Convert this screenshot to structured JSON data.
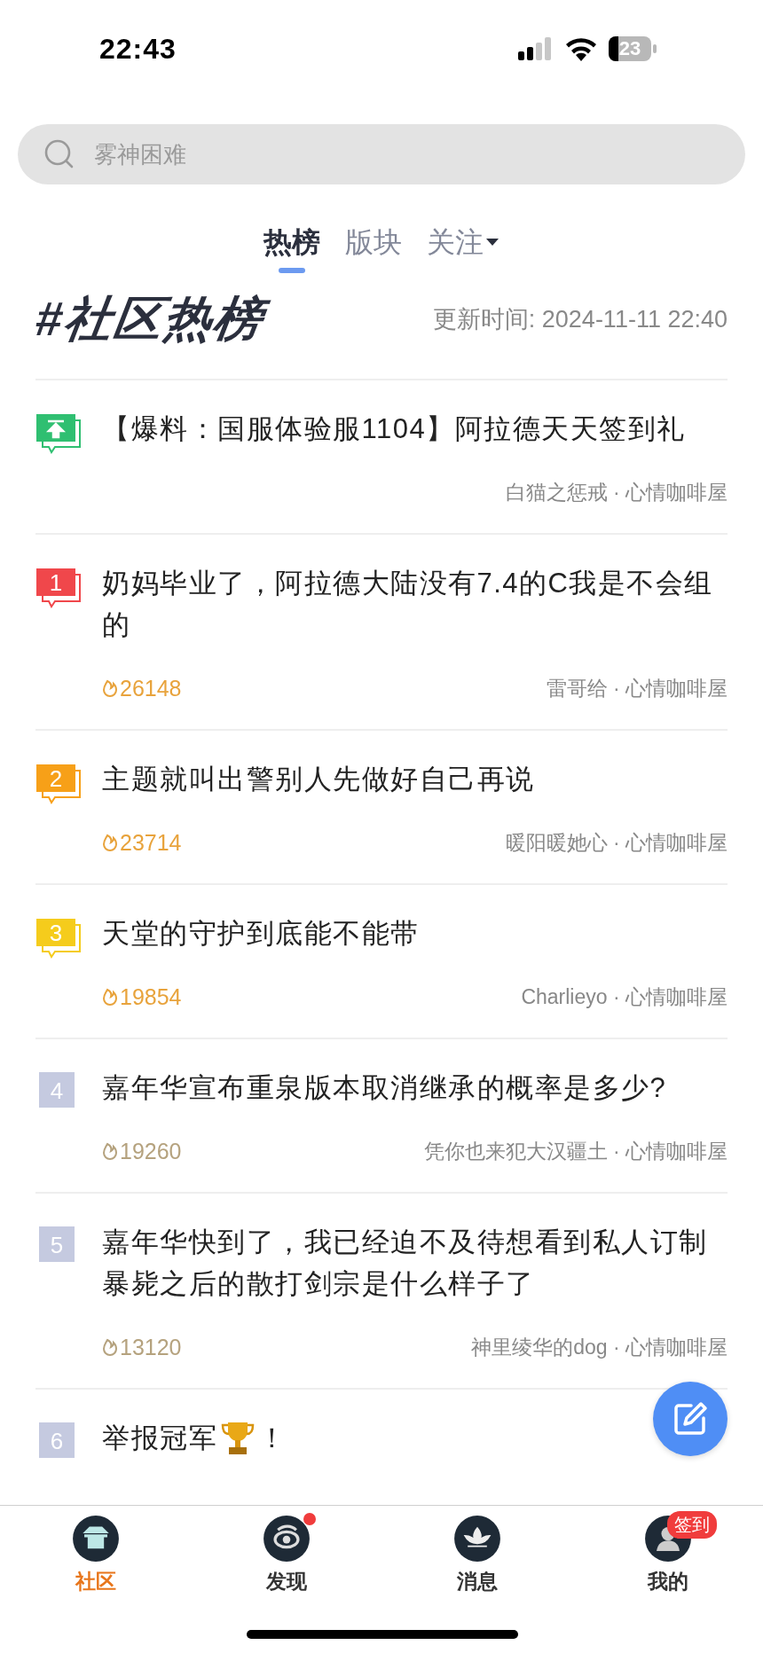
{
  "status_bar": {
    "time": "22:43",
    "battery": "23"
  },
  "search": {
    "placeholder": "雾神困难"
  },
  "tabs": [
    {
      "label": "热榜",
      "selected": true,
      "dropdown": false
    },
    {
      "label": "版块",
      "selected": false,
      "dropdown": false
    },
    {
      "label": "关注",
      "selected": false,
      "dropdown": true
    }
  ],
  "section": {
    "title": "#社区热榜",
    "updated": "更新时间: 2024-11-11 22:40"
  },
  "posts": [
    {
      "kind": "pinned",
      "color": "#2fbf71",
      "title": "【爆料：国服体验服1104】阿拉德天天签到礼",
      "meta": "白猫之惩戒 · 心情咖啡屋",
      "trophy": false
    },
    {
      "kind": "top",
      "rank": "1",
      "color": "#f0474b",
      "title": "奶妈毕业了，阿拉德大陆没有7.4的C我是不会组的",
      "heat": "26148",
      "meta": "雷哥给 · 心情咖啡屋",
      "trophy": false
    },
    {
      "kind": "top",
      "rank": "2",
      "color": "#f7a018",
      "title": "主题就叫出警别人先做好自己再说",
      "heat": "23714",
      "meta": "暖阳暖她心 · 心情咖啡屋",
      "trophy": false
    },
    {
      "kind": "top",
      "rank": "3",
      "color": "#f5cc1c",
      "title": "天堂的守护到底能不能带",
      "heat": "19854",
      "meta": "Charlieyo · 心情咖啡屋",
      "trophy": false
    },
    {
      "kind": "plain",
      "rank": "4",
      "color": "#c5cae0",
      "title": "嘉年华宣布重泉版本取消继承的概率是多少?",
      "heat": "19260",
      "meta": "凭你也来犯大汉疆土 · 心情咖啡屋",
      "trophy": false
    },
    {
      "kind": "plain",
      "rank": "5",
      "color": "#c5cae0",
      "title": "嘉年华快到了，我已经迫不及待想看到私人订制暴毙之后的散打剑宗是什么样子了",
      "heat": "13120",
      "meta": "神里绫华的dog · 心情咖啡屋",
      "trophy": false
    },
    {
      "kind": "plain",
      "rank": "6",
      "color": "#c5cae0",
      "title": "举报冠军",
      "trophy": true,
      "title_end": "！"
    }
  ],
  "nav": [
    {
      "label": "社区",
      "selected": true,
      "dot": false
    },
    {
      "label": "发现",
      "selected": false,
      "dot": true
    },
    {
      "label": "消息",
      "selected": false,
      "dot": false
    },
    {
      "label": "我的",
      "selected": false,
      "dot": false,
      "badge": "签到"
    }
  ]
}
